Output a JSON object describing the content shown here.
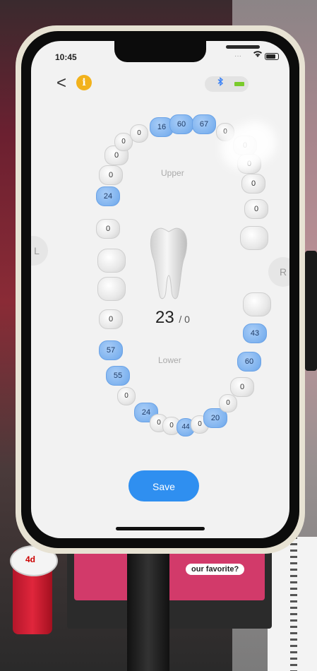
{
  "status_bar": {
    "time": "10:45",
    "dots": "···",
    "wifi": "wifi-icon"
  },
  "header": {
    "back": "<",
    "info": "i",
    "bluetooth": "bluetooth-icon"
  },
  "sides": {
    "left": "L",
    "right": "R"
  },
  "arch_labels": {
    "upper": "Upper",
    "lower": "Lower"
  },
  "teeth_upper": [
    {
      "value": "",
      "selected": false
    },
    {
      "value": "0",
      "selected": false
    },
    {
      "value": "24",
      "selected": true
    },
    {
      "value": "0",
      "selected": false
    },
    {
      "value": "0",
      "selected": false
    },
    {
      "value": "0",
      "selected": false
    },
    {
      "value": "0",
      "selected": false
    },
    {
      "value": "16",
      "selected": true
    },
    {
      "value": "60",
      "selected": true
    },
    {
      "value": "67",
      "selected": true
    },
    {
      "value": "0",
      "selected": false
    },
    {
      "value": "0",
      "selected": false
    },
    {
      "value": "0",
      "selected": false
    },
    {
      "value": "0",
      "selected": false
    },
    {
      "value": "0",
      "selected": false
    },
    {
      "value": "",
      "selected": false
    }
  ],
  "teeth_lower": [
    {
      "value": "",
      "selected": false
    },
    {
      "value": "0",
      "selected": false
    },
    {
      "value": "57",
      "selected": true
    },
    {
      "value": "55",
      "selected": true
    },
    {
      "value": "0",
      "selected": false
    },
    {
      "value": "24",
      "selected": true
    },
    {
      "value": "0",
      "selected": false
    },
    {
      "value": "0",
      "selected": false
    },
    {
      "value": "44",
      "selected": true
    },
    {
      "value": "0",
      "selected": false
    },
    {
      "value": "20",
      "selected": true
    },
    {
      "value": "0",
      "selected": false
    },
    {
      "value": "0",
      "selected": false
    },
    {
      "value": "60",
      "selected": true
    },
    {
      "value": "43",
      "selected": true
    },
    {
      "value": "",
      "selected": false
    }
  ],
  "summary": {
    "count": "23",
    "slash": "/ 0"
  },
  "actions": {
    "save": "Save"
  },
  "background": {
    "brochure_text": "our favorite?",
    "stamp_text": "4d"
  },
  "colors": {
    "selected": "#7fb3ef",
    "save": "#2f8ff0",
    "info": "#f2b21c"
  }
}
